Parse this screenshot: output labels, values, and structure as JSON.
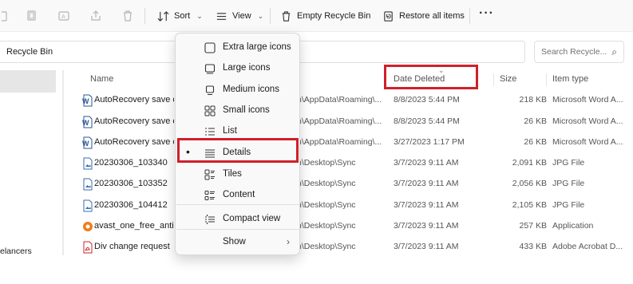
{
  "toolbar": {
    "sort_label": "Sort",
    "view_label": "View",
    "empty_label": "Empty Recycle Bin",
    "restore_label": "Restore all items",
    "more_label": "···",
    "chevron": "⌄"
  },
  "address": {
    "text": "Recycle Bin"
  },
  "search": {
    "placeholder": "Search Recycle...",
    "icon": "⌕"
  },
  "nav": {
    "truncated_item": "elancers"
  },
  "columns": {
    "name": "Name",
    "date": "Date Deleted",
    "size": "Size",
    "type": "Item type",
    "sort_caret": "⌄"
  },
  "rows": [
    {
      "name": "AutoRecovery save of D",
      "location": "n\\AppData\\Roaming\\...",
      "date": "8/8/2023 5:44 PM",
      "size": "218 KB",
      "type": "Microsoft Word A...",
      "icon": "word-file-icon"
    },
    {
      "name": "AutoRecovery save of D",
      "location": "n\\AppData\\Roaming\\...",
      "date": "8/8/2023 5:44 PM",
      "size": "26 KB",
      "type": "Microsoft Word A...",
      "icon": "word-file-icon"
    },
    {
      "name": "AutoRecovery save of D",
      "location": "n\\AppData\\Roaming\\...",
      "date": "3/27/2023 1:17 PM",
      "size": "26 KB",
      "type": "Microsoft Word A...",
      "icon": "word-file-icon"
    },
    {
      "name": "20230306_103340",
      "location": "n\\Desktop\\Sync",
      "date": "3/7/2023 9:11 AM",
      "size": "2,091 KB",
      "type": "JPG File",
      "icon": "image-file-icon"
    },
    {
      "name": "20230306_103352",
      "location": "n\\Desktop\\Sync",
      "date": "3/7/2023 9:11 AM",
      "size": "2,056 KB",
      "type": "JPG File",
      "icon": "image-file-icon"
    },
    {
      "name": "20230306_104412",
      "location": "n\\Desktop\\Sync",
      "date": "3/7/2023 9:11 AM",
      "size": "2,105 KB",
      "type": "JPG File",
      "icon": "image-file-icon"
    },
    {
      "name": "avast_one_free_antiviru",
      "location": "n\\Desktop\\Sync",
      "date": "3/7/2023 9:11 AM",
      "size": "257 KB",
      "type": "Application",
      "icon": "installer-icon"
    },
    {
      "name": "Div change request",
      "location": "n\\Desktop\\Sync",
      "date": "3/7/2023 9:11 AM",
      "size": "433 KB",
      "type": "Adobe Acrobat D...",
      "icon": "pdf-file-icon"
    }
  ],
  "view_menu": {
    "items": [
      {
        "label": "Extra large icons"
      },
      {
        "label": "Large icons"
      },
      {
        "label": "Medium icons"
      },
      {
        "label": "Small icons"
      },
      {
        "label": "List"
      },
      {
        "label": "Details",
        "selected": true
      },
      {
        "label": "Tiles"
      },
      {
        "label": "Content"
      },
      {
        "label": "Compact view"
      },
      {
        "label": "Show"
      }
    ],
    "bullet": "•",
    "submenu_arrow": "›"
  },
  "colors": {
    "highlight": "#d0202a",
    "word_blue": "#2b5797",
    "pdf_red": "#c62828"
  }
}
